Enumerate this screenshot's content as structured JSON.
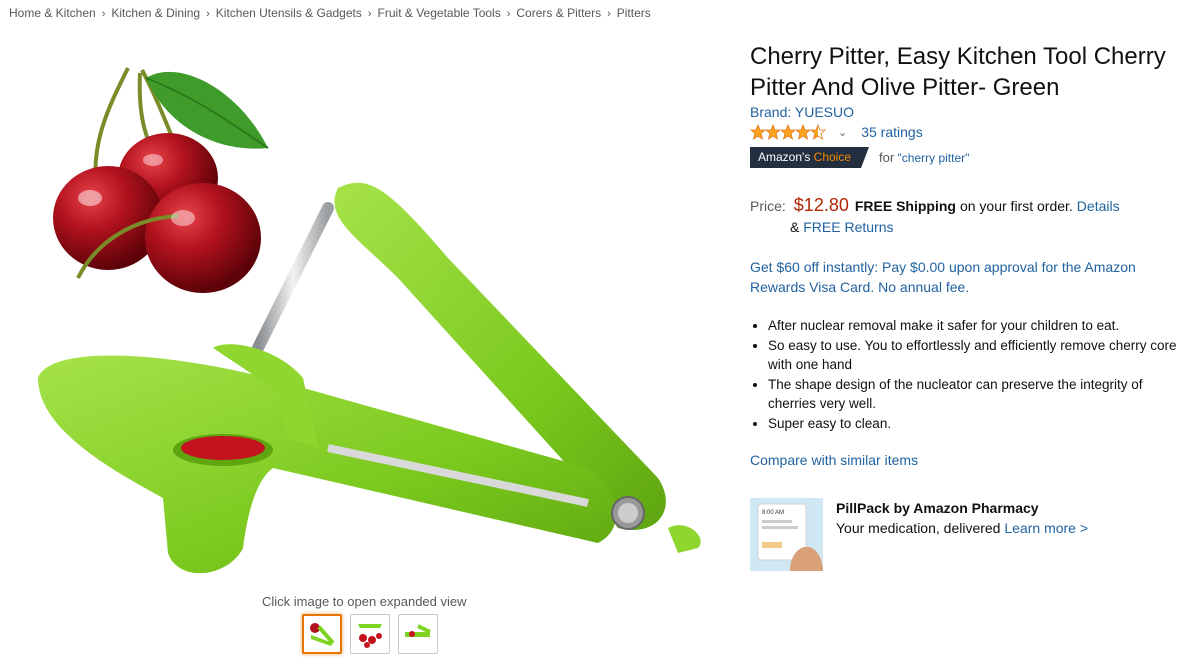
{
  "breadcrumb": [
    "Home & Kitchen",
    "Kitchen & Dining",
    "Kitchen Utensils & Gadgets",
    "Fruit & Vegetable Tools",
    "Corers & Pitters",
    "Pitters"
  ],
  "breadcrumb_separator": "›",
  "image": {
    "hint": "Click image to open expanded view"
  },
  "product": {
    "title": "Cherry Pitter, Easy Kitchen Tool Cherry Pitter And Olive Pitter- Green",
    "brand": "Brand: YUESUO",
    "rating_stars": 4.5,
    "rating_chevron": "⌄",
    "ratings_count": "35 ratings",
    "badge_prefix": "Amazon's",
    "badge_choice": "Choice",
    "badge_for": "for",
    "badge_query": "\"cherry pitter\"",
    "price_label": "Price:",
    "price": "$12.80",
    "free_shipping": "FREE Shipping",
    "shipping_rest": "on your first order.",
    "details_link": "Details",
    "returns_amp": "&",
    "returns_link": "FREE Returns",
    "promo": "Get $60 off instantly: Pay $0.00 upon approval for the Amazon Rewards Visa Card. No annual fee.",
    "bullets": [
      "After nuclear removal make it safer for your children to eat.",
      "So easy to use. You to effortlessly and efficiently remove cherry core with one hand",
      "The shape design of the nucleator can preserve the integrity of cherries very well.",
      "Super easy to clean."
    ],
    "compare_link": "Compare with similar items"
  },
  "pillpack": {
    "title": "PillPack by Amazon Pharmacy",
    "subtitle": "Your medication, delivered",
    "link": "Learn more >",
    "card_time": "8:00 AM"
  },
  "colors": {
    "link": "#2162a1",
    "price": "#b12704",
    "badge_bg": "#232f3e",
    "badge_accent": "#f08804",
    "star": "#ffa41c",
    "product_green": "#7ed321"
  }
}
